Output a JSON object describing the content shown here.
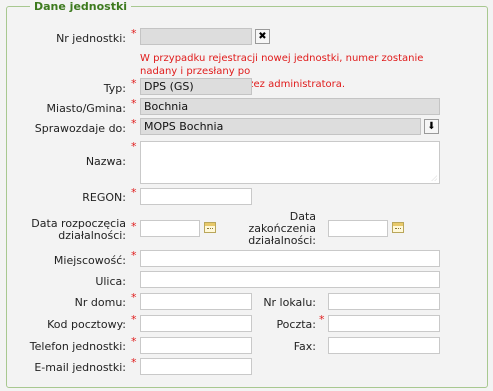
{
  "legend": "Dane jednostki",
  "nr_jednostki": {
    "label": "Nr jednostki:",
    "value": "",
    "clear_symbol": "✖",
    "note": [
      "W przypadku rejestracji nowej jednostki, numer zostanie nadany i przesłany po",
      "akceptacji wniosku przez administratora."
    ]
  },
  "typ": {
    "label": "Typ:",
    "value": "DPS (GS)"
  },
  "miasto": {
    "label": "Miasto/Gmina:",
    "value": "Bochnia"
  },
  "sprawozdaje": {
    "label": "Sprawozdaje do:",
    "value": "MOPS Bochnia",
    "button_symbol": "⬇"
  },
  "nazwa": {
    "label": "Nazwa:",
    "value": ""
  },
  "regon": {
    "label": "REGON:",
    "value": ""
  },
  "data_rozp": {
    "label_line1": "Data rozpoczęcia",
    "label_line2": "działalności:",
    "value": ""
  },
  "data_zak": {
    "label_line1": "Data",
    "label_line2": "zakończenia",
    "label_line3": "działalności:",
    "value": ""
  },
  "miejscowosc": {
    "label": "Miejscowość:",
    "value": ""
  },
  "ulica": {
    "label": "Ulica:",
    "value": ""
  },
  "nr_domu": {
    "label": "Nr domu:",
    "value": ""
  },
  "nr_lokalu": {
    "label": "Nr lokalu:",
    "value": ""
  },
  "kod": {
    "label": "Kod pocztowy:",
    "value": ""
  },
  "poczta": {
    "label": "Poczta:",
    "value": ""
  },
  "telefon": {
    "label": "Telefon jednostki:",
    "value": ""
  },
  "fax": {
    "label": "Fax:",
    "value": ""
  },
  "email": {
    "label": "E-mail jednostki:",
    "value": ""
  },
  "required_mark": "*",
  "colors": {
    "required": "#e01b1b",
    "legend": "#3d7a1e",
    "border": "#a8c890"
  }
}
